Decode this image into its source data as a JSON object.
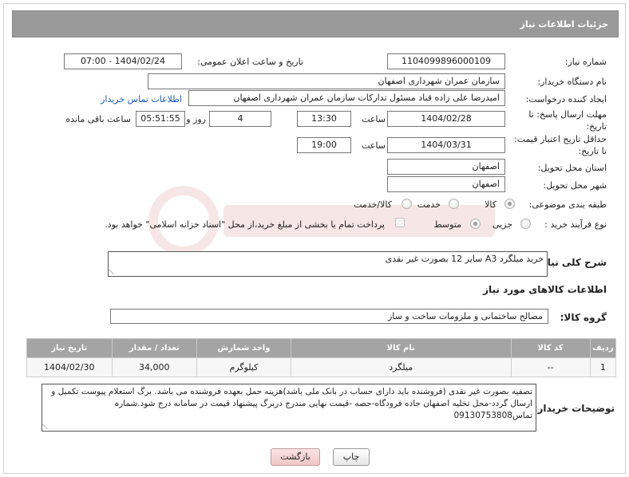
{
  "header": {
    "title": "جزئیات اطلاعات نیاز"
  },
  "fields": {
    "need_number_label": "شماره نیاز:",
    "need_number": "1104099896000109",
    "announce_label": "تاریخ و ساعت اعلان عمومی:",
    "announce_value": "1404/02/24 - 07:00",
    "buyer_org_label": "نام دستگاه خریدار:",
    "buyer_org": "سازمان عمران شهرداری اصفهان",
    "creator_label": "ایجاد کننده درخواست:",
    "creator": "امیدرضا علی زاده قناد مسئول تدارکات سازمان عمران شهرداری اصفهان",
    "contact_link": "اطلاعات تماس خریدار",
    "deadline_label_1": "مهلت ارسال پاسخ: تا",
    "deadline_label_2": "تاریخ:",
    "deadline_date": "1404/02/28",
    "time_label": "ساعت",
    "deadline_time": "13:30",
    "days_count": "4",
    "days_and_label": "روز و",
    "remaining_time": "05:51:55",
    "remaining_label": "ساعت باقی مانده",
    "validity_label_1": "حداقل تاریخ اعتبار قیمت:",
    "validity_label_2": "تا تاریخ:",
    "validity_date": "1404/03/31",
    "validity_time": "19:00",
    "province_label": "استان محل تحویل:",
    "province": "اصفهان",
    "city_label": "شهر محل تحویل:",
    "city": "اصفهان",
    "category_label": "طبقه بندی موضوعی:",
    "category_goods": "کالا",
    "category_service": "خدمت",
    "category_both": "کالا/خدمت",
    "process_label": "نوع فرآیند خرید :",
    "process_minor": "جزیی",
    "process_medium": "متوسط",
    "payment_note": "پرداخت تمام یا بخشی از مبلغ خرید،از محل \"اسناد خزانه اسلامی\" خواهد بود."
  },
  "description": {
    "label": "شرح کلی نیاز:",
    "value": "خرید میلگرد A3 سایز 12 بصورت غیر نقدی"
  },
  "goods_info_title": "اطلاعات کالاهای مورد نیاز",
  "goods_group": {
    "label": "گروه کالا:",
    "value": "مصالح ساختمانی و ملزومات ساخت و ساز"
  },
  "table": {
    "headers": [
      "ردیف",
      "کد کالا",
      "نام کالا",
      "واحد شمارش",
      "تعداد / مقدار",
      "تاریخ نیاز"
    ],
    "rows": [
      [
        "1",
        "--",
        "میلگرد",
        "کیلوگرم",
        "34,000",
        "1404/02/30"
      ]
    ]
  },
  "buyer_notes": {
    "label": "توضیحات خریدار:",
    "value": "تصفیه بصورت غیر نقدی (فروشنده باید دارای حساب در بانک ملی باشد)هزینه حمل بعهده فروشنده می باشد. برگ استعلام پیوست تکمیل و ارسال گردد-محل تخلیه اصفهان جاده فرودگاه-حصه -قیمت نهایی مندرج دربرگ پیشنهاد قیمت در سامانه درج شود.شماره تماس09130753808"
  },
  "buttons": {
    "print": "چاپ",
    "back": "بازگشت"
  },
  "icons": {
    "watermark": "watermark-logo-icon",
    "resize": "resize-grip-icon"
  },
  "colors": {
    "header_bg": "#9a9a9a",
    "table_header_bg": "#a4a4a4",
    "link": "#1a55c8",
    "back_button_bg": "#f0c6c6"
  }
}
